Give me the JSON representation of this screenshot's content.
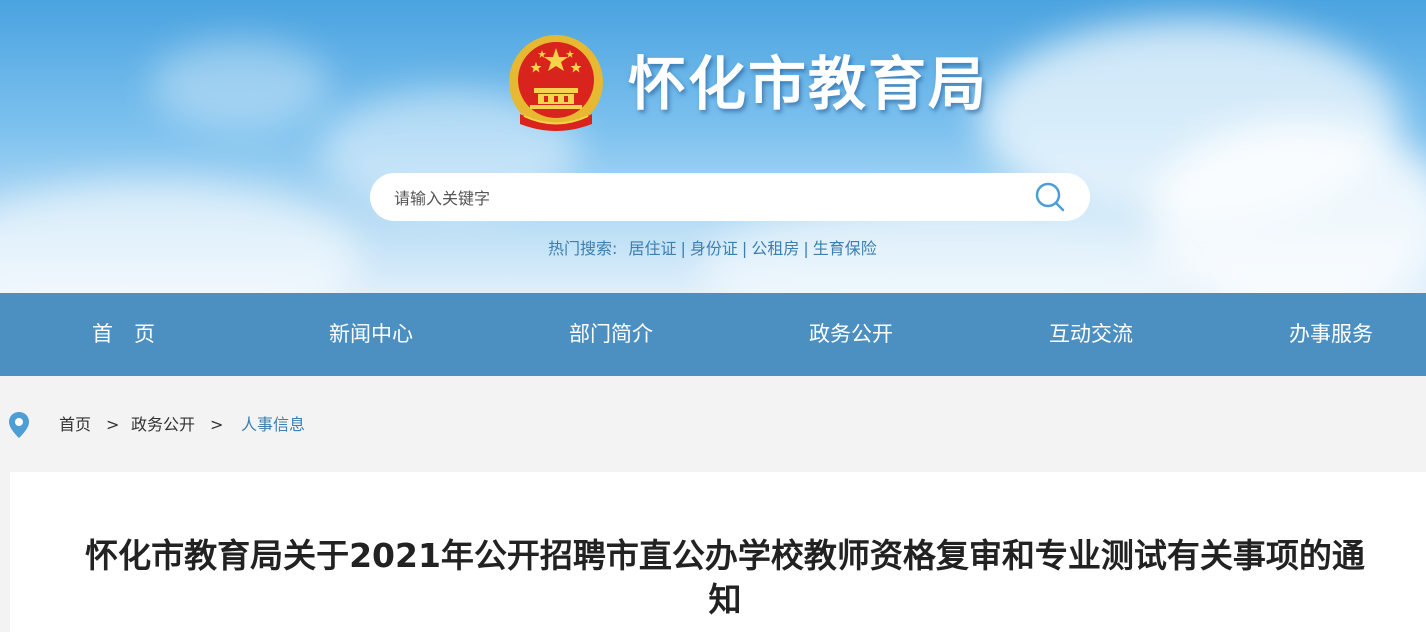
{
  "header": {
    "site_title": "怀化市教育局",
    "emblem_icon": "national-emblem-icon",
    "search": {
      "placeholder": "请输入关键字",
      "value": ""
    },
    "hot_search": {
      "label": "热门搜索:",
      "items": [
        "居住证",
        "身份证",
        "公租房",
        "生育保险"
      ]
    }
  },
  "nav": {
    "items": [
      "首　页",
      "新闻中心",
      "部门简介",
      "政务公开",
      "互动交流",
      "办事服务"
    ]
  },
  "breadcrumb": {
    "icon": "location-pin-icon",
    "items": [
      "首页",
      "政务公开",
      "人事信息"
    ],
    "separator": ">"
  },
  "article": {
    "title": "怀化市教育局关于2021年公开招聘市直公办学校教师资格复审和专业测试有关事项的通知"
  },
  "colors": {
    "nav_bg": "#4c8fc1",
    "link": "#3c7fb1",
    "title_text": "#222222"
  }
}
